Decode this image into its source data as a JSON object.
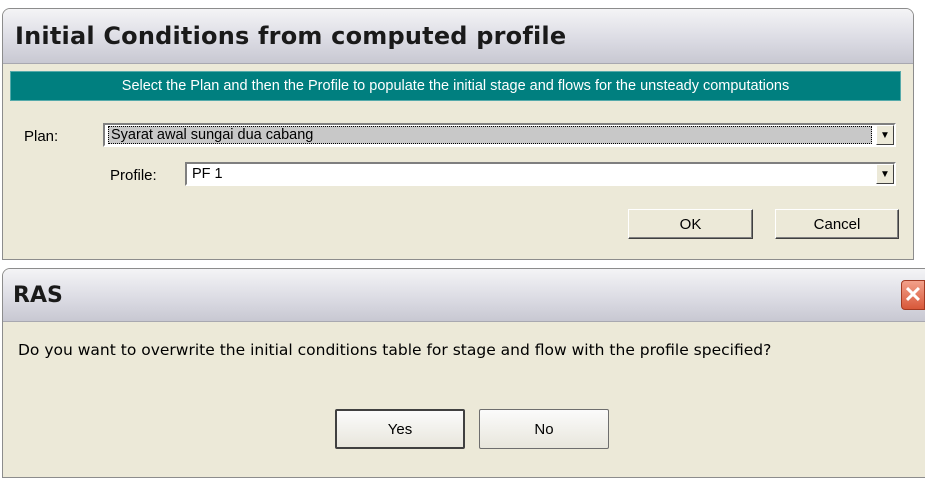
{
  "dialog1": {
    "title": "Initial Conditions from computed profile",
    "instruction": "Select the Plan and then the Profile to populate the initial stage and flows for the unsteady computations",
    "plan_label": "Plan:",
    "plan_value": "Syarat awal sungai dua cabang",
    "profile_label": "Profile:",
    "profile_value": "PF 1",
    "ok_label": "OK",
    "cancel_label": "Cancel",
    "dropdown_icon": "chevron-down-icon"
  },
  "dialog2": {
    "title": "RAS",
    "message": "Do you want to overwrite the initial conditions table for stage and flow with the profile specified?",
    "yes_label": "Yes",
    "no_label": "No",
    "close_icon": "close-icon"
  },
  "colors": {
    "banner": "#007f7f",
    "dialog_bg": "#ece9d8",
    "close_button": "#d8583a"
  }
}
